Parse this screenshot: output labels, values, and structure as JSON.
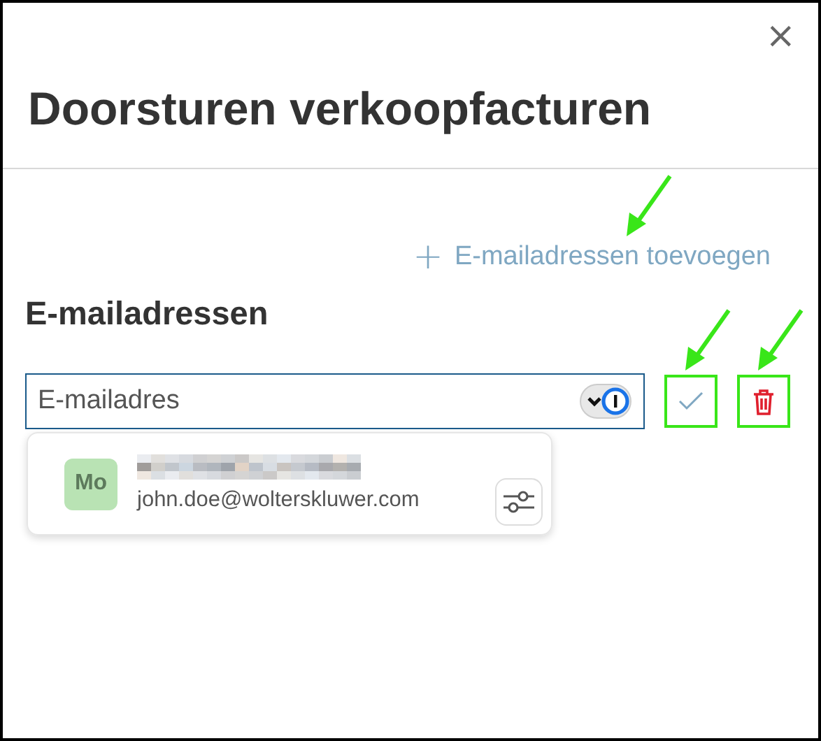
{
  "dialog": {
    "title": "Doorsturen verkoopfacturen",
    "close_icon": "×"
  },
  "add_link": {
    "icon": "+",
    "label": "E-mailadressen toevoegen",
    "arrow": true
  },
  "section_title": "E-mailadressen",
  "email_field": {
    "placeholder": "E-mailadres"
  },
  "confirm_button": {
    "arrow": true,
    "boxed": true
  },
  "delete_button": {
    "arrow": true,
    "boxed": true
  },
  "suggestion": {
    "initials": "Mo",
    "color": "#b9e3b4",
    "name_redacted": true,
    "email": "john.doe@wolterskluwer.com"
  }
}
